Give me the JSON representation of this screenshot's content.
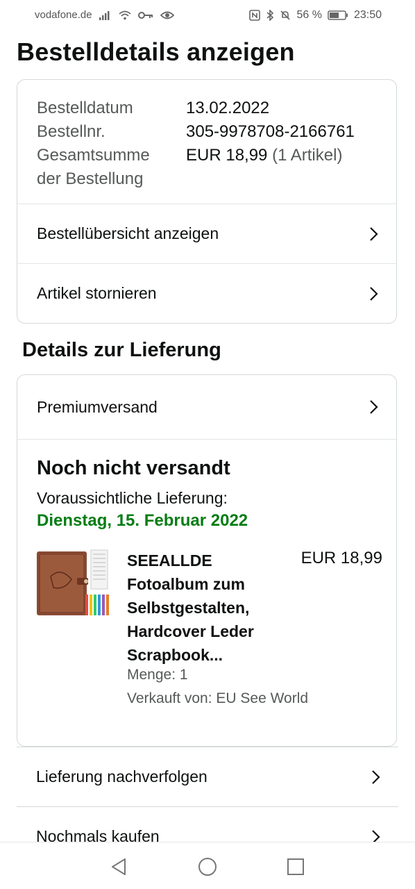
{
  "status_bar": {
    "carrier": "vodafone.de",
    "battery": "56 %",
    "time": "23:50"
  },
  "page": {
    "title": "Bestelldetails anzeigen"
  },
  "order": {
    "date_label": "Bestelldatum",
    "date_value": "13.02.2022",
    "number_label": "Bestellnr.",
    "number_value": "305-9978708-2166761",
    "total_label_line1": "Gesamtsumme",
    "total_label_line2": "der Bestellung",
    "total_value": "EUR 18,99",
    "total_items": "(1 Artikel)",
    "links": [
      {
        "label": "Bestellübersicht anzeigen"
      },
      {
        "label": "Artikel stornieren"
      }
    ]
  },
  "delivery": {
    "section_title": "Details zur Lieferung",
    "shipping_method": "Premiumversand",
    "status": "Noch nicht versandt",
    "eta_label": "Voraussichtliche Lieferung:",
    "eta_date": "Dienstag, 15. Februar 2022",
    "eta_color": "#067d14",
    "product": {
      "title_lines": [
        "SEEALLDE",
        "Fotoalbum zum",
        "Selbstgestalten,",
        "Hardcover Leder",
        "Scrapbook..."
      ],
      "price": "EUR 18,99",
      "quantity": "Menge: 1",
      "seller": "Verkauft von: EU See World"
    }
  },
  "actions": [
    {
      "label": "Lieferung nachverfolgen"
    },
    {
      "label": "Nochmals kaufen"
    }
  ],
  "icons": {
    "signal": "signal-icon",
    "wifi": "wifi-icon",
    "key": "key-icon",
    "eye": "eye-icon",
    "nfc": "nfc-icon",
    "bluetooth": "bluetooth-icon",
    "mute": "bell-off-icon",
    "battery": "battery-icon",
    "chevron": "chevron-right-icon"
  }
}
